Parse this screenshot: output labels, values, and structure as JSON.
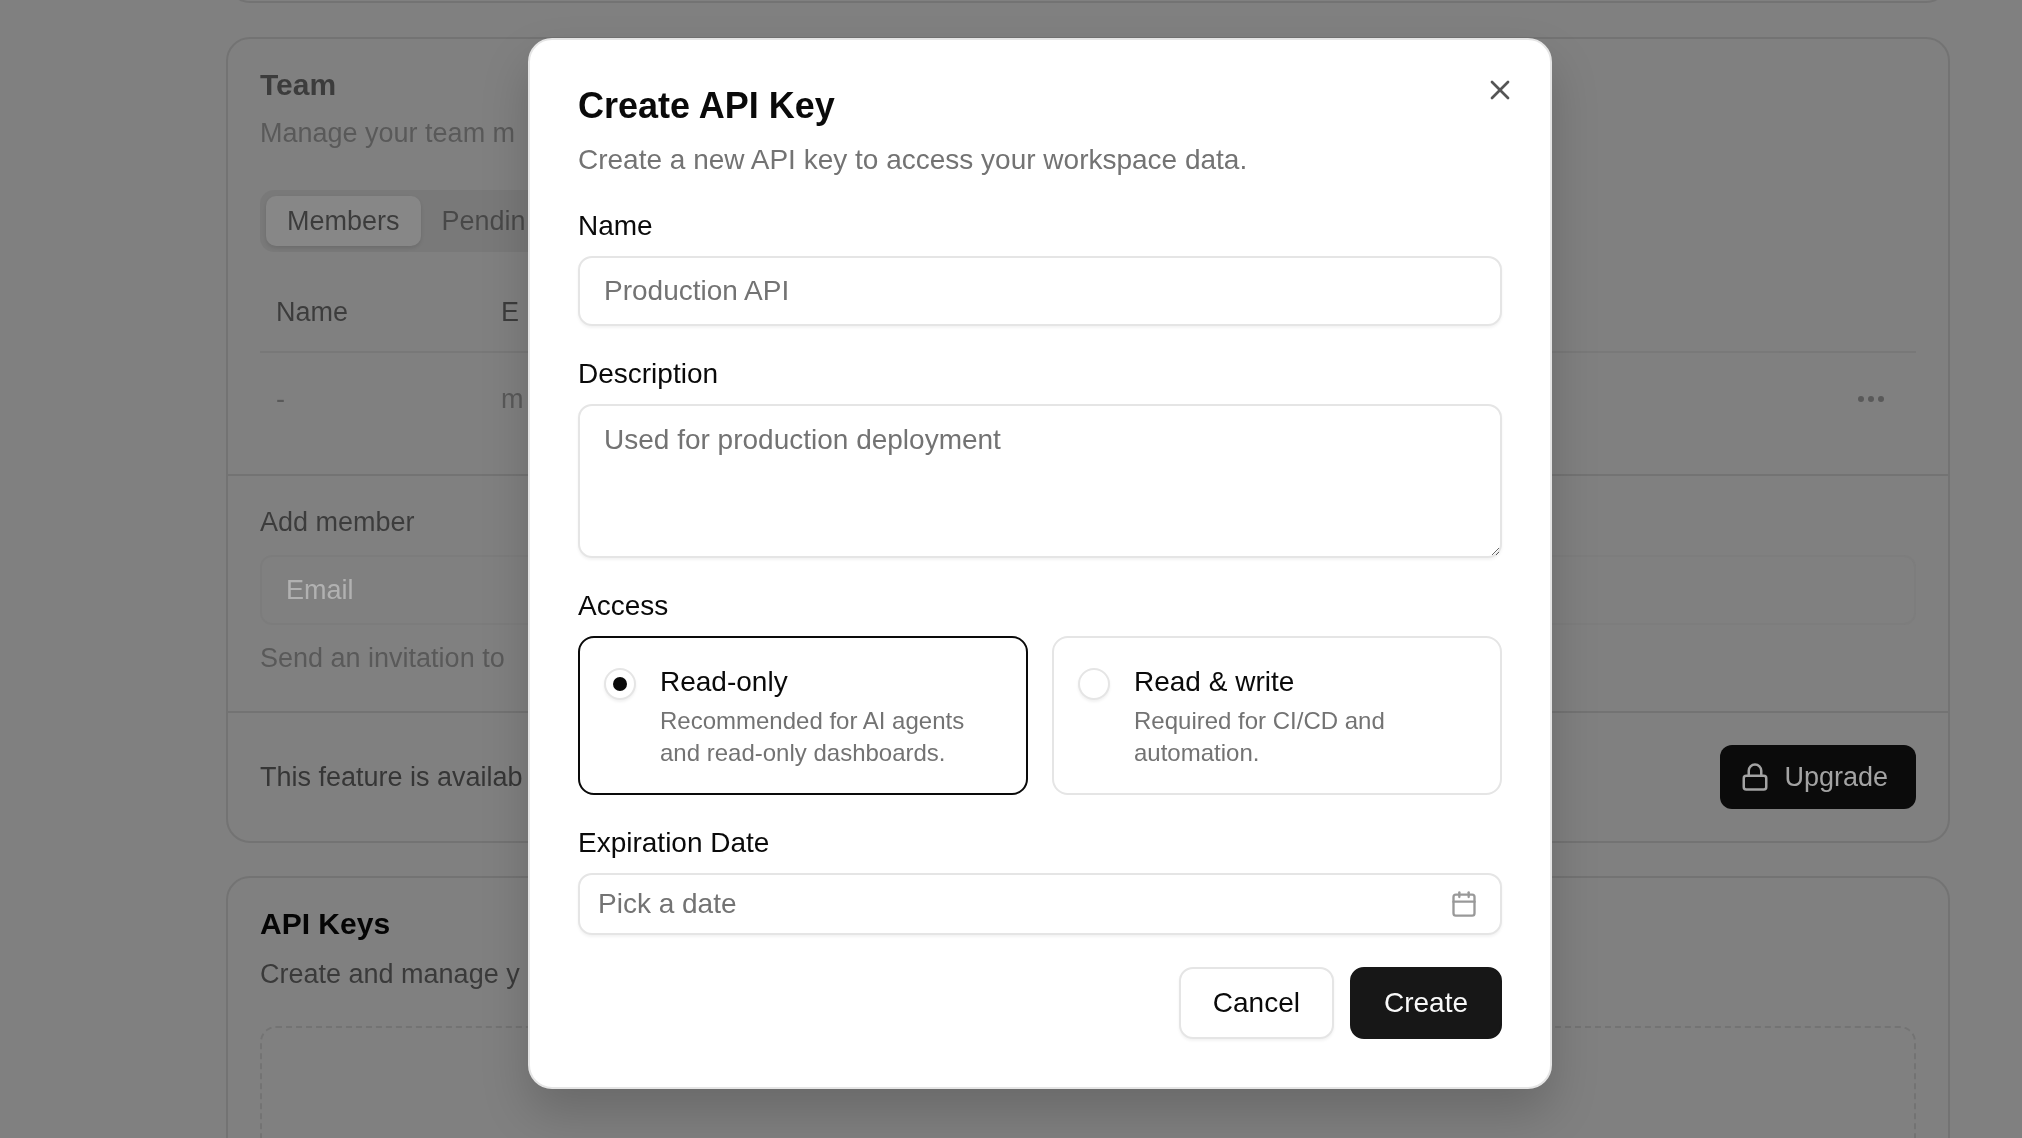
{
  "team": {
    "title": "Team",
    "description": "Manage your team m",
    "disabled": true,
    "tabs": [
      {
        "label": "Members",
        "selected": true
      },
      {
        "label": "Pendin",
        "selected": false
      }
    ],
    "table": {
      "columns": [
        "Name",
        "E"
      ],
      "rows": [
        {
          "cells": [
            "-",
            "m"
          ]
        }
      ]
    },
    "add_member": {
      "label": "Add member",
      "email": {
        "placeholder": "Email"
      },
      "hint": "Send an invitation to"
    },
    "footer": {
      "text": "This feature is availab",
      "button": "Upgrade"
    }
  },
  "api_keys": {
    "title": "API Keys",
    "description": "Create and manage y"
  },
  "dialog": {
    "title": "Create API Key",
    "description": "Create a new API key to access your workspace data.",
    "fields": [
      {
        "kind": "text",
        "label": "Name",
        "placeholder": "Production API"
      },
      {
        "kind": "textarea",
        "label": "Description",
        "placeholder": "Used for production deployment"
      },
      {
        "kind": "radio",
        "label": "Access",
        "options": [
          {
            "title": "Read-only",
            "description": "Recommended for AI agents and read-only dashboards.",
            "selected": true
          },
          {
            "title": "Read & write",
            "description": "Required for CI/CD and automation.",
            "selected": false
          }
        ]
      },
      {
        "kind": "date",
        "label": "Expiration Date",
        "placeholder": "Pick a date"
      }
    ],
    "buttons": [
      {
        "label": "Cancel",
        "kind": "cancel"
      },
      {
        "label": "Create",
        "kind": "submit"
      }
    ]
  }
}
